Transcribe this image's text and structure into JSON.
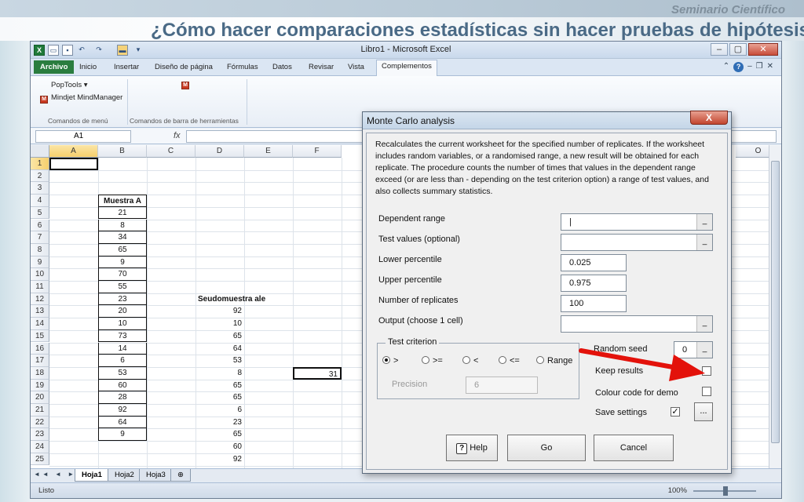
{
  "slide": {
    "header": "Seminario Científico",
    "title": "¿Cómo hacer comparaciones estadísticas sin hacer pruebas de hipótesis?"
  },
  "window": {
    "title": "Libro1  -  Microsoft Excel"
  },
  "ribbon": {
    "tabs": [
      "Archivo",
      "Inicio",
      "Insertar",
      "Diseño de página",
      "Fórmulas",
      "Datos",
      "Revisar",
      "Vista",
      "Complementos"
    ],
    "active_tab": "Complementos",
    "poptools_label": "PopTools ▾",
    "mindjet_label": "Mindjet MindManager",
    "group_menu_label": "Comandos de menú",
    "group_toolbar_label": "Comandos de barra de herramientas"
  },
  "formula_bar": {
    "name_box": "A1",
    "fx": "fx"
  },
  "grid": {
    "columns": [
      "A",
      "B",
      "C",
      "D",
      "E",
      "F",
      "O"
    ],
    "rows": [
      "1",
      "2",
      "3",
      "4",
      "5",
      "6",
      "7",
      "8",
      "9",
      "10",
      "11",
      "12",
      "13",
      "14",
      "15",
      "16",
      "17",
      "18",
      "19",
      "20",
      "21",
      "22",
      "23",
      "24",
      "25"
    ],
    "muestra_header": "Muestra A",
    "muestra_values": [
      "21",
      "8",
      "34",
      "65",
      "9",
      "70",
      "55",
      "23",
      "20",
      "10",
      "73",
      "14",
      "6",
      "53",
      "60",
      "28",
      "92",
      "64",
      "9"
    ],
    "seudo_header": "Seudomuestra ale",
    "seudo_values": [
      "92",
      "10",
      "65",
      "64",
      "53",
      "8",
      "65",
      "65",
      "6",
      "23",
      "65",
      "60",
      "92"
    ],
    "f18_value": "31"
  },
  "sheets": {
    "tabs": [
      "Hoja1",
      "Hoja2",
      "Hoja3"
    ],
    "active": "Hoja1"
  },
  "status": {
    "mode": "Listo",
    "zoom": "100%"
  },
  "dialog": {
    "title": "Monte Carlo analysis",
    "close_label": "X",
    "description": "Recalculates the current worksheet for the specified number of replicates. If the worksheet includes random variables, or a randomised range, a new result will be obtained for each replicate. The procedure counts the number of times that values in the dependent range exceed (or are less than - depending on the test criterion option) a range of test values, and also collects summary statistics.",
    "fields": {
      "dependent_range_label": "Dependent range",
      "dependent_range_value": "|",
      "test_values_label": "Test values (optional)",
      "test_values_value": "",
      "lower_percentile_label": "Lower percentile",
      "lower_percentile_value": "0.025",
      "upper_percentile_label": "Upper percentile",
      "upper_percentile_value": "0.975",
      "replicates_label": "Number of replicates",
      "replicates_value": "100",
      "output_label": "Output (choose 1 cell)",
      "output_value": ""
    },
    "picker_glyph": "_",
    "test_criterion": {
      "title": "Test criterion",
      "options": [
        ">",
        ">=",
        "<",
        "<=",
        "Range"
      ],
      "selected": ">",
      "precision_label": "Precision",
      "precision_value": "6"
    },
    "random_seed_label": "Random seed",
    "random_seed_value": "0",
    "keep_results_label": "Keep results",
    "keep_results_checked": false,
    "colour_code_label": "Colour code for demo",
    "colour_code_checked": false,
    "save_settings_label": "Save settings",
    "save_settings_checked": true,
    "check_mark": "✓",
    "ellipsis_label": "...",
    "help_glyph": "?",
    "help_label": "Help",
    "go_label": "Go",
    "cancel_label": "Cancel"
  },
  "colors": {
    "arrow": "#e3120b",
    "title": "#4a6a86",
    "excel_green": "#2a7d3f"
  }
}
